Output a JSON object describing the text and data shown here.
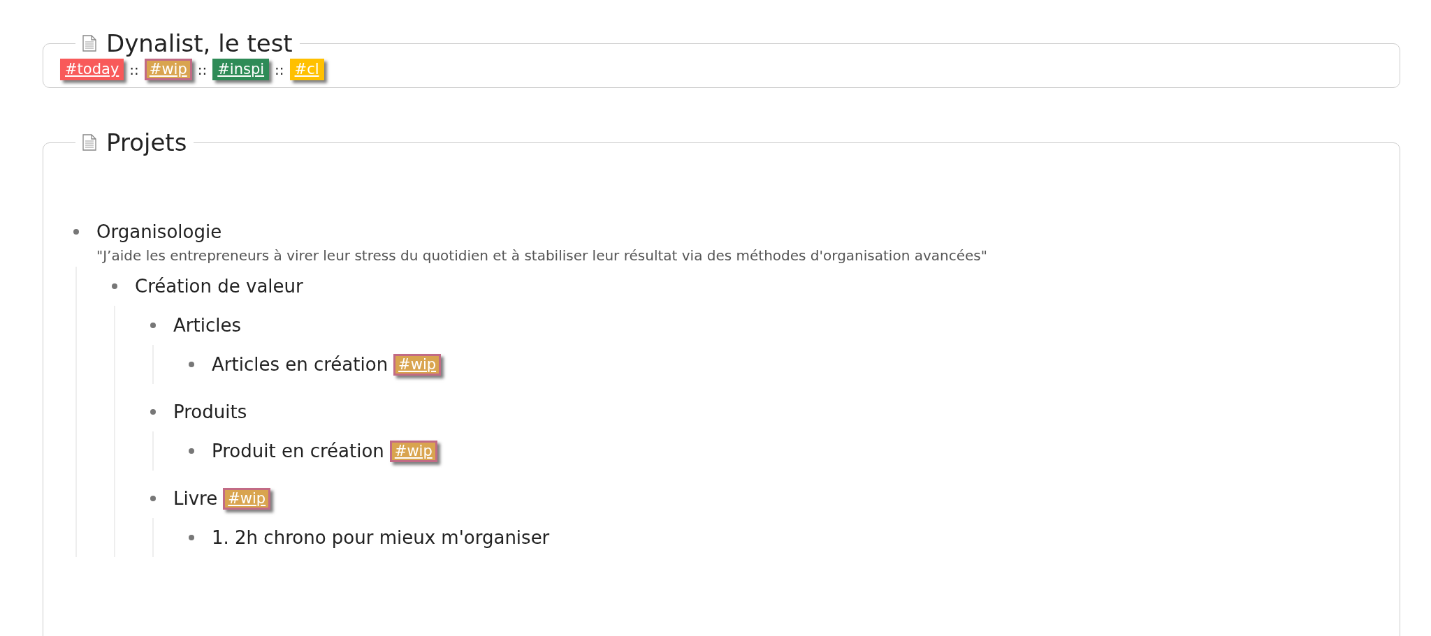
{
  "sections": [
    {
      "title": "Dynalist, le test",
      "tags_line": {
        "separator": "::",
        "tags": [
          {
            "label": "#today",
            "color": "#f85a5a",
            "outlined": false
          },
          {
            "label": "#wip",
            "color": "#d9a44f",
            "outlined": true
          },
          {
            "label": "#inspi",
            "color": "#2e8b57",
            "outlined": false
          },
          {
            "label": "#cl",
            "color": "#ffc000",
            "outlined": false
          }
        ]
      }
    },
    {
      "title": "Projets",
      "items": [
        {
          "text": "Organisologie",
          "note": "\"J’aide les entrepreneurs à virer leur stress du quotidien et à stabiliser leur résultat via des méthodes d'organisation avancées\"",
          "children": [
            {
              "text": "Création de valeur",
              "children": [
                {
                  "text": "Articles",
                  "children": [
                    {
                      "text": "Articles en création",
                      "tags": [
                        {
                          "label": "#wip",
                          "color": "#d9a44f",
                          "outlined": true
                        }
                      ]
                    }
                  ]
                },
                {
                  "text": "Produits",
                  "children": [
                    {
                      "text": "Produit en création",
                      "tags": [
                        {
                          "label": "#wip",
                          "color": "#d9a44f",
                          "outlined": true
                        }
                      ]
                    }
                  ]
                },
                {
                  "text": "Livre",
                  "tags": [
                    {
                      "label": "#wip",
                      "color": "#d9a44f",
                      "outlined": true
                    }
                  ],
                  "children": [
                    {
                      "text": "1. 2h chrono pour mieux m'organiser"
                    }
                  ]
                }
              ]
            }
          ]
        }
      ]
    }
  ]
}
